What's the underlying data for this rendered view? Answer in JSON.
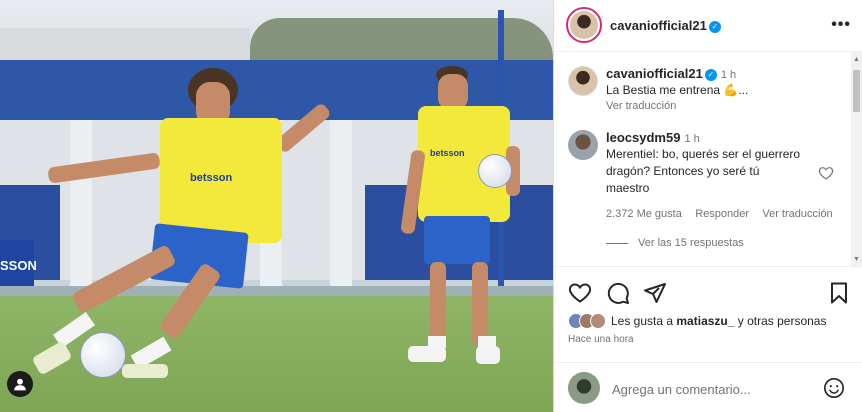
{
  "post": {
    "author": "cavaniofficial21",
    "verified": true
  },
  "photo": {
    "sponsor_left": "betsson",
    "sponsor_right": "betsson",
    "adboard_text": "SSON"
  },
  "caption": {
    "author": "cavaniofficial21",
    "time": "1 h",
    "text": "La Bestia me entrena 💪...",
    "translate": "Ver traducción"
  },
  "comment": {
    "author": "leocsydm59",
    "time": "1 h",
    "text": "Merentiel: bo, querés ser el guerrero dragón? Entonces yo seré tú maestro",
    "likes": "2.372 Me gusta",
    "reply": "Responder",
    "translate": "Ver traducción",
    "view_replies": "Ver las 15 respuestas"
  },
  "likes": {
    "prefix": "Les gusta a ",
    "user": "matiaszu_",
    "suffix": " y otras personas"
  },
  "posted_time": "Hace una hora",
  "add_comment": {
    "placeholder": "Agrega un comentario..."
  },
  "icons": {
    "more": "more-icon",
    "like": "heart-icon",
    "comment": "comment-icon",
    "share": "share-icon",
    "save": "bookmark-icon",
    "emoji": "emoji-icon",
    "tag": "user-tag-icon"
  },
  "colors": {
    "verified": "#0095f6",
    "story_ring": "#d62976",
    "text": "#262626",
    "muted": "#737373"
  }
}
